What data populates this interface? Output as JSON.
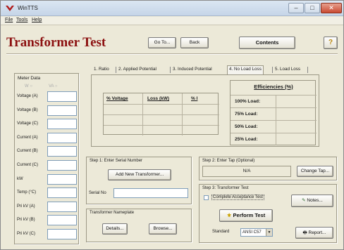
{
  "window": {
    "title": "WinTTS"
  },
  "menu": {
    "file": "File",
    "tools": "Tools",
    "help": "Help"
  },
  "header": {
    "title": "Transformer Test",
    "goto_label": "Go To...",
    "back_label": "Back",
    "contents_label": "Contents",
    "help_label": "?"
  },
  "meter": {
    "title": "Meter Data",
    "radio_a": "W",
    "radio_b": "VA",
    "rows": [
      {
        "label": "Voltage (A)"
      },
      {
        "label": "Voltage (B)"
      },
      {
        "label": "Voltage (C)"
      },
      {
        "label": "Current (A)"
      },
      {
        "label": "Current (B)"
      },
      {
        "label": "Current (C)"
      },
      {
        "label": "kW"
      },
      {
        "label": "Temp (°C)"
      },
      {
        "label": "Pri kV (A)"
      },
      {
        "label": "Pri kV (B)"
      },
      {
        "label": "Pri kV (C)"
      }
    ]
  },
  "tabs": [
    {
      "label": "1. Ratio"
    },
    {
      "label": "2. Applied Potential"
    },
    {
      "label": "3. Induced Potential"
    },
    {
      "label": "4. No Load Loss"
    },
    {
      "label": "5. Load Loss"
    }
  ],
  "results": {
    "col_voltage": "% Voltage",
    "col_loss": "Loss (kW)",
    "col_current": "% I"
  },
  "efficiencies": {
    "title": "Efficiencies (%)",
    "rows": [
      {
        "label": "100% Load:"
      },
      {
        "label": "75% Load:"
      },
      {
        "label": "50% Load:"
      },
      {
        "label": "25% Load:"
      }
    ]
  },
  "step1": {
    "title": "Step 1: Enter Serial Number",
    "add_label": "Add New Transformer...",
    "serial_label": "Serial No"
  },
  "nameplate": {
    "title": "Transformer Nameplate",
    "details_label": "Details...",
    "browse_label": "Browse..."
  },
  "step2": {
    "title": "Step 2: Enter Tap (Optional)",
    "tap_value": "N/A",
    "change_tap_label": "Change Tap..."
  },
  "step3": {
    "title": "Step 3: Transformer Test",
    "acceptance_label": "Complete Acceptance Test",
    "notes_label": "Notes...",
    "perform_label": "Perform Test",
    "standard_label": "Standard",
    "standard_value": "ANSI C57",
    "report_label": "Report..."
  }
}
